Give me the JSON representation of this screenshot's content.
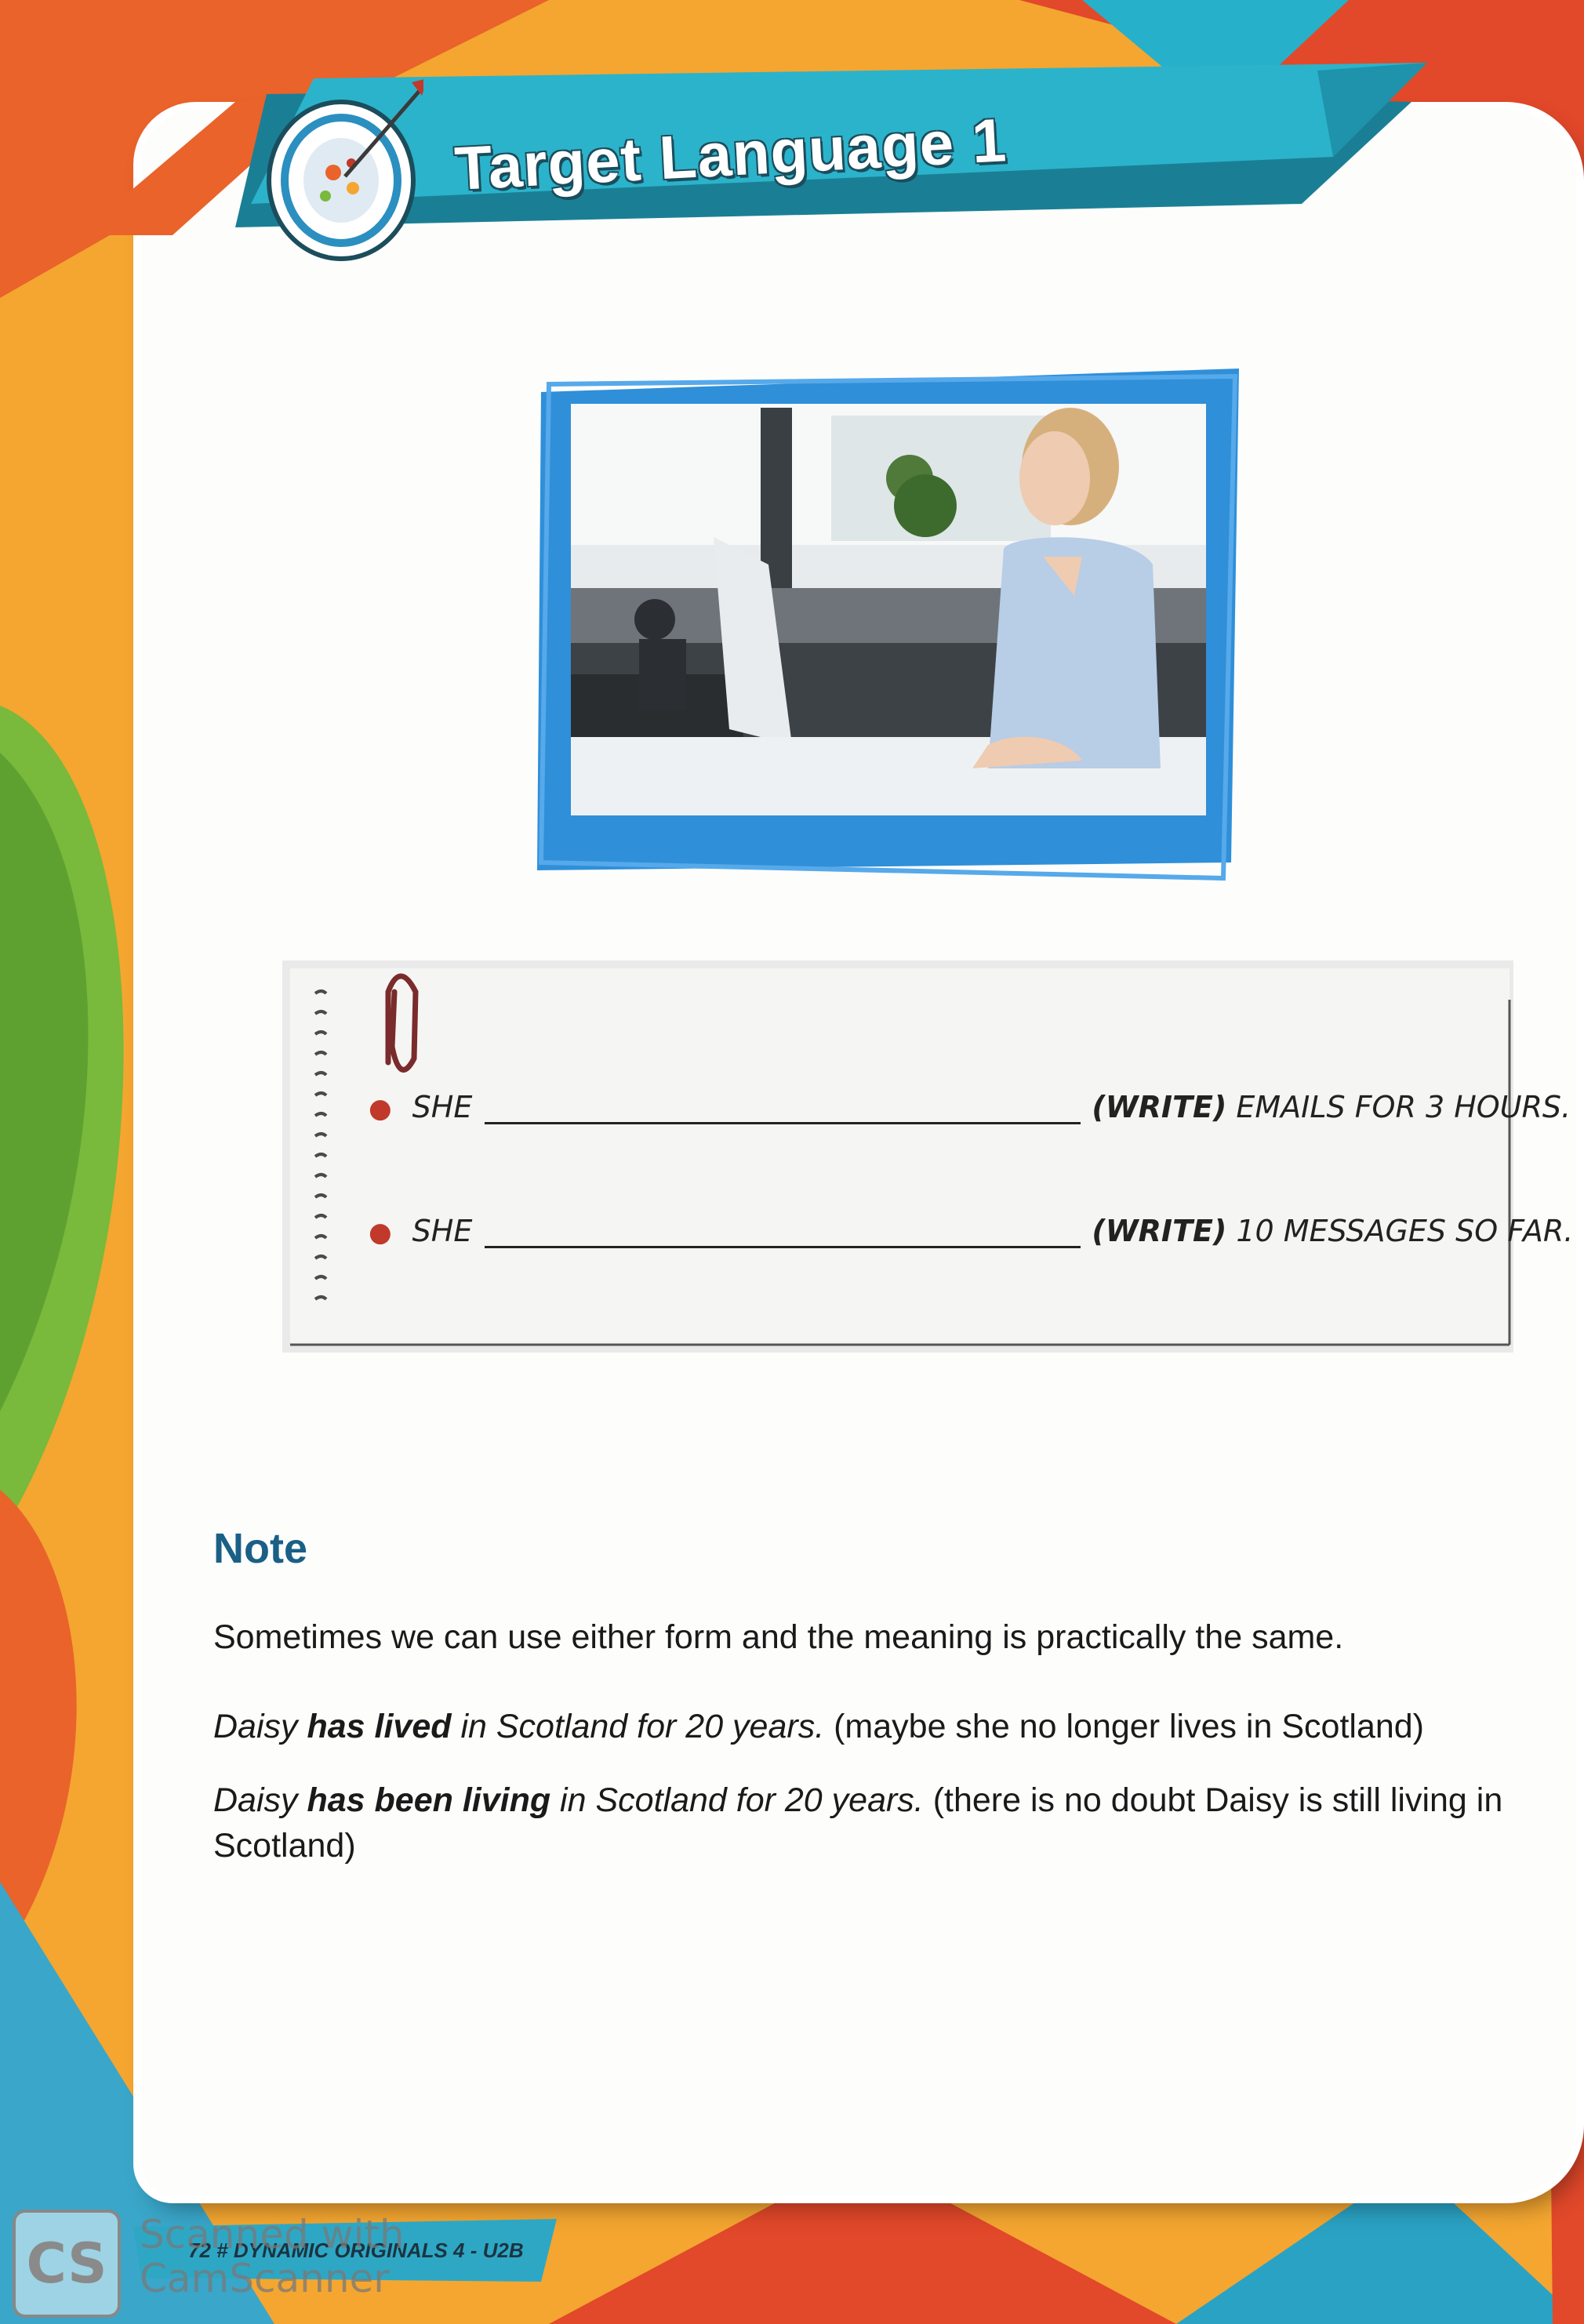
{
  "header": {
    "title": "Target Language 1"
  },
  "exercise": {
    "items": [
      {
        "subject": "SHE",
        "verb": "(WRITE)",
        "rest": "EMAILS FOR 3 HOURS."
      },
      {
        "subject": "SHE",
        "verb": "(WRITE)",
        "rest": "10 MESSAGES SO FAR."
      }
    ]
  },
  "note": {
    "heading": "Note",
    "intro": "Sometimes we can use either form and the meaning is practically the same.",
    "ex1": {
      "pre": "Daisy ",
      "bold": "has lived",
      "post": " in Scotland for 20 years.",
      "comment": " (maybe she no longer lives in Scotland)"
    },
    "ex2": {
      "pre": "Daisy ",
      "bold": "has been living",
      "post": " in Scotland for 20 years.",
      "comment": " (there is no doubt Daisy is still living in",
      "comment2": "Scotland)"
    }
  },
  "footer": {
    "text": "72 # DYNAMIC ORIGINALS 4 - U2B"
  },
  "watermark": {
    "logo": "CS",
    "line1": "Scanned with",
    "line2": "CamScanner"
  }
}
